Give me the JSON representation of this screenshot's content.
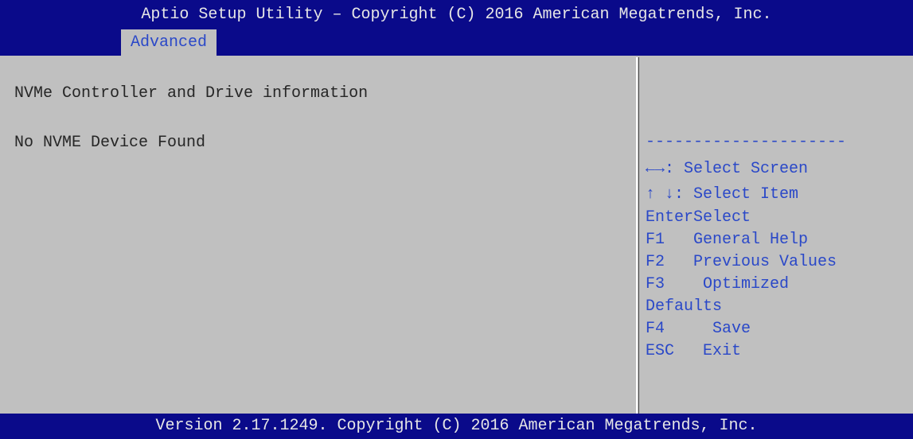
{
  "header": {
    "title": "Aptio Setup Utility – Copyright (C) 2016 American Megatrends, Inc.",
    "tabs": [
      {
        "label": "Advanced",
        "active": true
      }
    ]
  },
  "main": {
    "section_title": "NVMe Controller and Drive information",
    "status_text": "No NVME Device Found"
  },
  "help": {
    "separator": "---------------------",
    "keys": [
      {
        "key": "←→",
        "desc": ": Select Screen"
      },
      {
        "key": "↑ ↓",
        "desc": ": Select Item"
      },
      {
        "key": "Enter",
        "desc": "Select"
      },
      {
        "key": "F1",
        "desc": "   General Help"
      },
      {
        "key": "F2",
        "desc": "   Previous Values"
      },
      {
        "key": "F3",
        "desc": "    Optimized"
      },
      {
        "key": "",
        "desc": "Defaults"
      },
      {
        "key": "F4",
        "desc": "     Save"
      },
      {
        "key": "ESC",
        "desc": "   Exit"
      }
    ]
  },
  "footer": {
    "version": "Version 2.17.1249. Copyright (C) 2016 American Megatrends, Inc."
  },
  "colors": {
    "bar_background": "#0a0a8a",
    "panel_background": "#c0c0c0",
    "help_text": "#2a48c8",
    "body_text": "#262626",
    "bar_text": "#e6e6e6"
  }
}
